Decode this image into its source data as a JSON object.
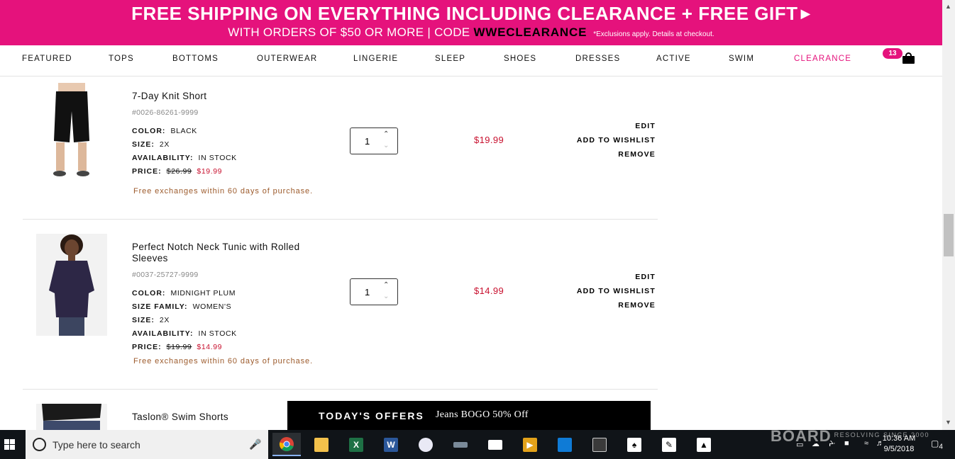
{
  "promo": {
    "line1": "FREE SHIPPING ON EVERYTHING INCLUDING CLEARANCE + FREE GIFT",
    "line2_prefix": "WITH ORDERS OF $50 OR MORE | CODE",
    "code": "WWECLEARANCE",
    "fine_print": "*Exclusions apply. Details at checkout."
  },
  "nav": {
    "items": [
      "FEATURED",
      "TOPS",
      "BOTTOMS",
      "OUTERWEAR",
      "LINGERIE",
      "SLEEP",
      "SHOES",
      "DRESSES",
      "ACTIVE",
      "SWIM",
      "CLEARANCE"
    ],
    "bag_count": "13"
  },
  "cart": {
    "items": [
      {
        "name": "7-Day Knit Short",
        "sku": "#0026-86261-9999",
        "attributes": [
          {
            "label": "COLOR:",
            "value": "BLACK"
          },
          {
            "label": "SIZE:",
            "value": "2X"
          },
          {
            "label": "AVAILABILITY:",
            "value": "IN STOCK"
          }
        ],
        "price_label": "PRICE:",
        "original_price": "$26.99",
        "sale_price": "$19.99",
        "exchange_note": "Free exchanges within 60 days of purchase.",
        "quantity": "1",
        "line_price": "$19.99",
        "actions": [
          "EDIT",
          "ADD TO WISHLIST",
          "REMOVE"
        ]
      },
      {
        "name": "Perfect Notch Neck Tunic with Rolled Sleeves",
        "sku": "#0037-25727-9999",
        "attributes": [
          {
            "label": "COLOR:",
            "value": "MIDNIGHT PLUM"
          },
          {
            "label": "SIZE FAMILY:",
            "value": "WOMEN'S"
          },
          {
            "label": "SIZE:",
            "value": "2X"
          },
          {
            "label": "AVAILABILITY:",
            "value": "IN STOCK"
          }
        ],
        "price_label": "PRICE:",
        "original_price": "$19.99",
        "sale_price": "$14.99",
        "exchange_note": "Free exchanges within 60 days of purchase.",
        "quantity": "1",
        "line_price": "$14.99",
        "actions": [
          "EDIT",
          "ADD TO WISHLIST",
          "REMOVE"
        ]
      },
      {
        "name": "Taslon® Swim Shorts"
      }
    ]
  },
  "offers": {
    "title": "TODAY'S OFFERS",
    "deal": "Jeans BOGO 50% Off"
  },
  "taskbar": {
    "search_placeholder": "Type here to search",
    "apps": [
      "chrome-icon",
      "file-explorer-icon",
      "excel-icon",
      "word-icon",
      "paint-icon",
      "app-icon",
      "mail-icon",
      "media-player-icon",
      "store-icon",
      "calculator-icon",
      "solitaire-icon",
      "app-icon",
      "photos-icon"
    ],
    "time": "10:36 AM",
    "date": "9/5/2018",
    "notification_count": "4"
  },
  "watermark": {
    "brand": "BOARD",
    "tagline": "RESOLVING SINCE 2000"
  },
  "colors": {
    "brand_pink": "#e5127c",
    "sale_red": "#c8102e",
    "exchange_brown": "#9c5a2b"
  }
}
